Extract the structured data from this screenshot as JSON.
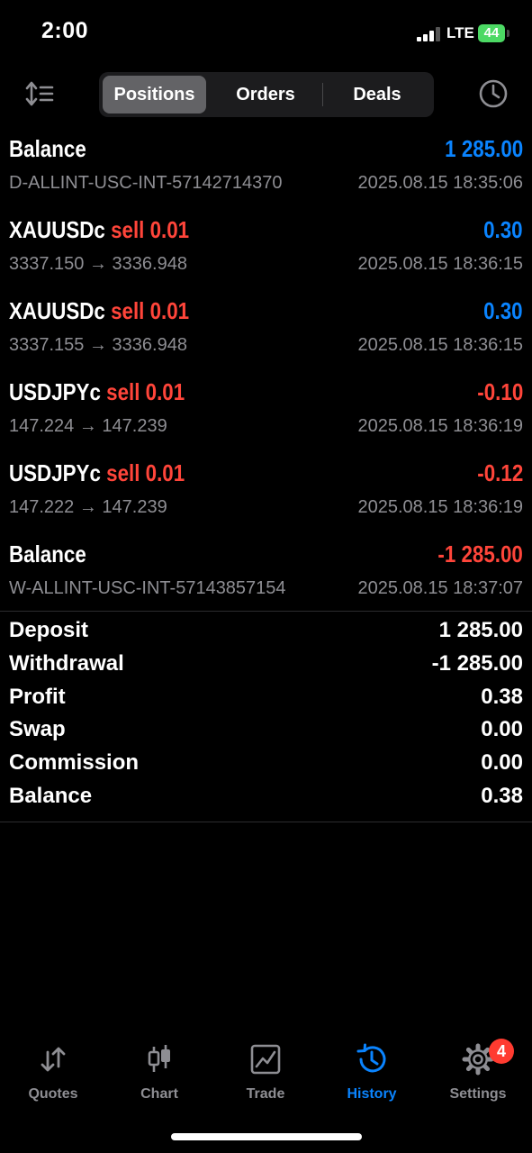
{
  "status": {
    "time": "2:00",
    "network": "LTE",
    "battery": "44"
  },
  "segments": [
    "Positions",
    "Orders",
    "Deals"
  ],
  "history": [
    {
      "title": "Balance",
      "side": "",
      "value": "1 285.00",
      "value_color": "blue",
      "detail": "D-ALLINT-USC-INT-57142714370",
      "time": "2025.08.15 18:35:06"
    },
    {
      "title": "XAUUSDc",
      "side": "sell 0.01",
      "value": "0.30",
      "value_color": "blue",
      "detail": "3337.150 → 3336.948",
      "time": "2025.08.15 18:36:15"
    },
    {
      "title": "XAUUSDc",
      "side": "sell 0.01",
      "value": "0.30",
      "value_color": "blue",
      "detail": "3337.155 → 3336.948",
      "time": "2025.08.15 18:36:15"
    },
    {
      "title": "USDJPYc",
      "side": "sell 0.01",
      "value": "-0.10",
      "value_color": "red",
      "detail": "147.224 → 147.239",
      "time": "2025.08.15 18:36:19"
    },
    {
      "title": "USDJPYc",
      "side": "sell 0.01",
      "value": "-0.12",
      "value_color": "red",
      "detail": "147.222 → 147.239",
      "time": "2025.08.15 18:36:19"
    },
    {
      "title": "Balance",
      "side": "",
      "value": "-1 285.00",
      "value_color": "red",
      "detail": "W-ALLINT-USC-INT-57143857154",
      "time": "2025.08.15 18:37:07"
    }
  ],
  "summary": [
    {
      "label": "Deposit",
      "value": "1 285.00"
    },
    {
      "label": "Withdrawal",
      "value": "-1 285.00"
    },
    {
      "label": "Profit",
      "value": "0.38"
    },
    {
      "label": "Swap",
      "value": "0.00"
    },
    {
      "label": "Commission",
      "value": "0.00"
    },
    {
      "label": "Balance",
      "value": "0.38"
    }
  ],
  "tabs": [
    {
      "label": "Quotes",
      "icon": "quotes-arrows-icon"
    },
    {
      "label": "Chart",
      "icon": "candlestick-icon"
    },
    {
      "label": "Trade",
      "icon": "trade-chart-icon"
    },
    {
      "label": "History",
      "icon": "history-clock-icon"
    },
    {
      "label": "Settings",
      "icon": "gear-icon"
    }
  ],
  "settings_badge": "4",
  "colors": {
    "blue": "#0a84ff",
    "red": "#ff453a",
    "background": "#000000",
    "muted": "#8e8e93"
  }
}
